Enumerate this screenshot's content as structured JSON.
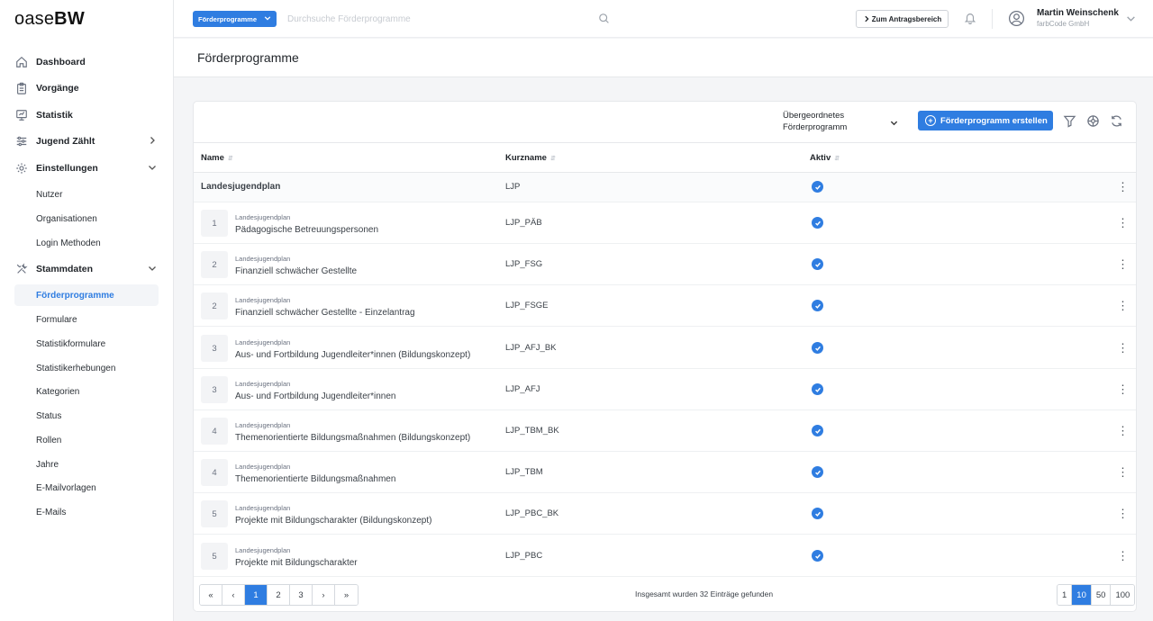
{
  "brand": {
    "logo_light": "oase",
    "logo_bold": "BW"
  },
  "sidebar": {
    "items": [
      {
        "label": "Dashboard",
        "icon": "home-icon"
      },
      {
        "label": "Vorgänge",
        "icon": "clipboard-icon"
      },
      {
        "label": "Statistik",
        "icon": "presentation-icon"
      },
      {
        "label": "Jugend Zählt",
        "icon": "sliders-icon"
      },
      {
        "label": "Einstellungen",
        "icon": "gear-icon"
      },
      {
        "label": "Stammdaten",
        "icon": "tools-icon"
      }
    ],
    "settings_sub": [
      "Nutzer",
      "Organisationen",
      "Login Methoden"
    ],
    "masterdata_sub": [
      "Förderprogramme",
      "Formulare",
      "Statistikformulare",
      "Statistikerhebungen",
      "Kategorien",
      "Status",
      "Rollen",
      "Jahre",
      "E-Mailvorlagen",
      "E-Mails"
    ],
    "active_item": "Förderprogramme"
  },
  "header": {
    "program_select": "Förderprogramme",
    "search_placeholder": "Durchsuche Förderprogramme",
    "antrag_button": "Zum Antragsbereich",
    "user_name": "Martin Weinschenk",
    "user_org": "farbCode GmbH"
  },
  "page": {
    "title": "Förderprogramme"
  },
  "toolbar": {
    "parent_select_line1": "Übergeordnetes",
    "parent_select_line2": "Förderprogramm",
    "create_button": "Förderprogramm erstellen"
  },
  "table": {
    "columns": [
      "Name",
      "Kurzname",
      "Aktiv"
    ],
    "group": {
      "name": "Landesjugendplan",
      "short": "LJP",
      "active": true
    },
    "rows": [
      {
        "num": "1",
        "parent": "Landesjugendplan",
        "name": "Pädagogische Betreuungspersonen",
        "short": "LJP_PÄB",
        "active": true
      },
      {
        "num": "2",
        "parent": "Landesjugendplan",
        "name": "Finanziell schwächer Gestellte",
        "short": "LJP_FSG",
        "active": true
      },
      {
        "num": "2",
        "parent": "Landesjugendplan",
        "name": "Finanziell schwächer Gestellte - Einzelantrag",
        "short": "LJP_FSGE",
        "active": true
      },
      {
        "num": "3",
        "parent": "Landesjugendplan",
        "name": "Aus- und Fortbildung Jugendleiter*innen (Bildungskonzept)",
        "short": "LJP_AFJ_BK",
        "active": true
      },
      {
        "num": "3",
        "parent": "Landesjugendplan",
        "name": "Aus- und Fortbildung Jugendleiter*innen",
        "short": "LJP_AFJ",
        "active": true
      },
      {
        "num": "4",
        "parent": "Landesjugendplan",
        "name": "Themenorientierte Bildungsmaßnahmen (Bildungskonzept)",
        "short": "LJP_TBM_BK",
        "active": true
      },
      {
        "num": "4",
        "parent": "Landesjugendplan",
        "name": "Themenorientierte Bildungsmaßnahmen",
        "short": "LJP_TBM",
        "active": true
      },
      {
        "num": "5",
        "parent": "Landesjugendplan",
        "name": "Projekte mit Bildungscharakter (Bildungskonzept)",
        "short": "LJP_PBC_BK",
        "active": true
      },
      {
        "num": "5",
        "parent": "Landesjugendplan",
        "name": "Projekte mit Bildungscharakter",
        "short": "LJP_PBC",
        "active": true
      }
    ]
  },
  "pagination": {
    "first": "«",
    "prev": "‹",
    "pages": [
      "1",
      "2",
      "3"
    ],
    "current_page": "1",
    "next": "›",
    "last": "»",
    "total_text": "Insgesamt wurden 32 Einträge gefunden",
    "page_sizes": [
      "1",
      "10",
      "50",
      "100"
    ],
    "current_size": "10"
  },
  "colors": {
    "accent": "#2f7de1"
  }
}
